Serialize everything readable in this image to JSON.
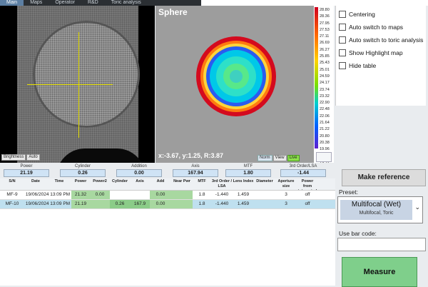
{
  "tabs": [
    "Main",
    "Maps",
    "Operator",
    "R&D",
    "Toric analysis"
  ],
  "camera": {
    "btn_brightness": "Brightness",
    "btn_auto": "Auto"
  },
  "map": {
    "title": "Sphere",
    "coords": "x:-3.67, y:1.25, R:3.87",
    "btn_norm": "Norm",
    "btn_view": "View",
    "btn_live": "Live"
  },
  "scale": {
    "values": [
      "28.80",
      "28.36",
      "27.95",
      "27.53",
      "27.11",
      "26.69",
      "26.27",
      "25.85",
      "25.43",
      "25.01",
      "24.59",
      "24.17",
      "23.74",
      "23.32",
      "22.90",
      "22.48",
      "22.06",
      "21.64",
      "21.22",
      "20.80",
      "20.38",
      "19.96",
      "19.54",
      "19.12",
      "18.69",
      "18.27",
      "17.85",
      "17.43",
      "17.01",
      "16.59",
      "16.17",
      "15.75",
      "15.32",
      "14.90",
      "14.48"
    ]
  },
  "options": [
    {
      "label": "Centering"
    },
    {
      "label": "Auto switch to maps"
    },
    {
      "label": "Auto switch to toric analysis"
    },
    {
      "label": "Show Highlight map"
    },
    {
      "label": "Hide table"
    }
  ],
  "params": {
    "power": {
      "label": "Power",
      "value": "21.19"
    },
    "cylinder": {
      "label": "Cylinder",
      "value": "0.26"
    },
    "addition": {
      "label": "Addition",
      "value": "0.00"
    },
    "axis": {
      "label": "Axis",
      "value": "167.94"
    },
    "mtf": {
      "label": "MTF",
      "value": "1.80"
    },
    "third": {
      "label": "3rd Order/LSA",
      "value": "-1.44"
    }
  },
  "table": {
    "headers": [
      "S/N",
      "Date",
      "Time",
      "Power",
      "Power2",
      "Cylinder",
      "Axis",
      "Add",
      "Near Pwr",
      "MTF",
      "3rd Order / LSA",
      "Lens Index",
      "Diameter",
      "Aperture size",
      "Power from integrated"
    ],
    "rows": [
      {
        "sn": "MF-9",
        "datetime": "19/06/2024 13:09 PM",
        "power": "21.32",
        "power2": "0.00",
        "cylinder": "",
        "axis": "",
        "add": "0.00",
        "near": "",
        "mtf": "1.8",
        "third": "-1.440",
        "index": "1.459",
        "diameter": "",
        "aperture": "3",
        "integrated": "off"
      },
      {
        "sn": "MF-10",
        "datetime": "19/06/2024 13:09 PM",
        "power": "21.19",
        "power2": "",
        "cylinder": "0.26",
        "axis": "167.9",
        "add": "0.00",
        "near": "",
        "mtf": "1.8",
        "third": "-1.440",
        "index": "1.459",
        "diameter": "",
        "aperture": "3",
        "integrated": "off"
      }
    ]
  },
  "right": {
    "make_reference": "Make reference",
    "preset_label": "Preset:",
    "preset_main": "Multifocal (Wet)",
    "preset_sub": "Multifocal, Toric",
    "barcode_label": "Use bar code:",
    "barcode_value": "",
    "measure": "Measure"
  }
}
